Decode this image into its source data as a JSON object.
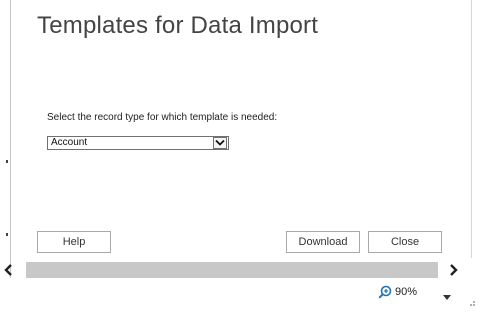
{
  "dialog": {
    "title": "Templates for Data Import",
    "prompt": "Select the record type for which template is needed:",
    "record_type": {
      "selected": "Account"
    },
    "buttons": {
      "help": "Help",
      "download": "Download",
      "close": "Close"
    }
  },
  "statusbar": {
    "zoom": "90%"
  },
  "colors": {
    "scrollbar": "#c8c8c8",
    "zoom_icon": "#1e73b4",
    "title_text": "#444444"
  },
  "icons": {
    "select_arrow": "chevron-down-icon",
    "scroll_left": "chevron-left-icon",
    "scroll_right": "chevron-right-icon",
    "zoom": "zoom-icon",
    "zoom_dropdown": "triangle-down-icon",
    "resize": "resize-grip-icon"
  }
}
